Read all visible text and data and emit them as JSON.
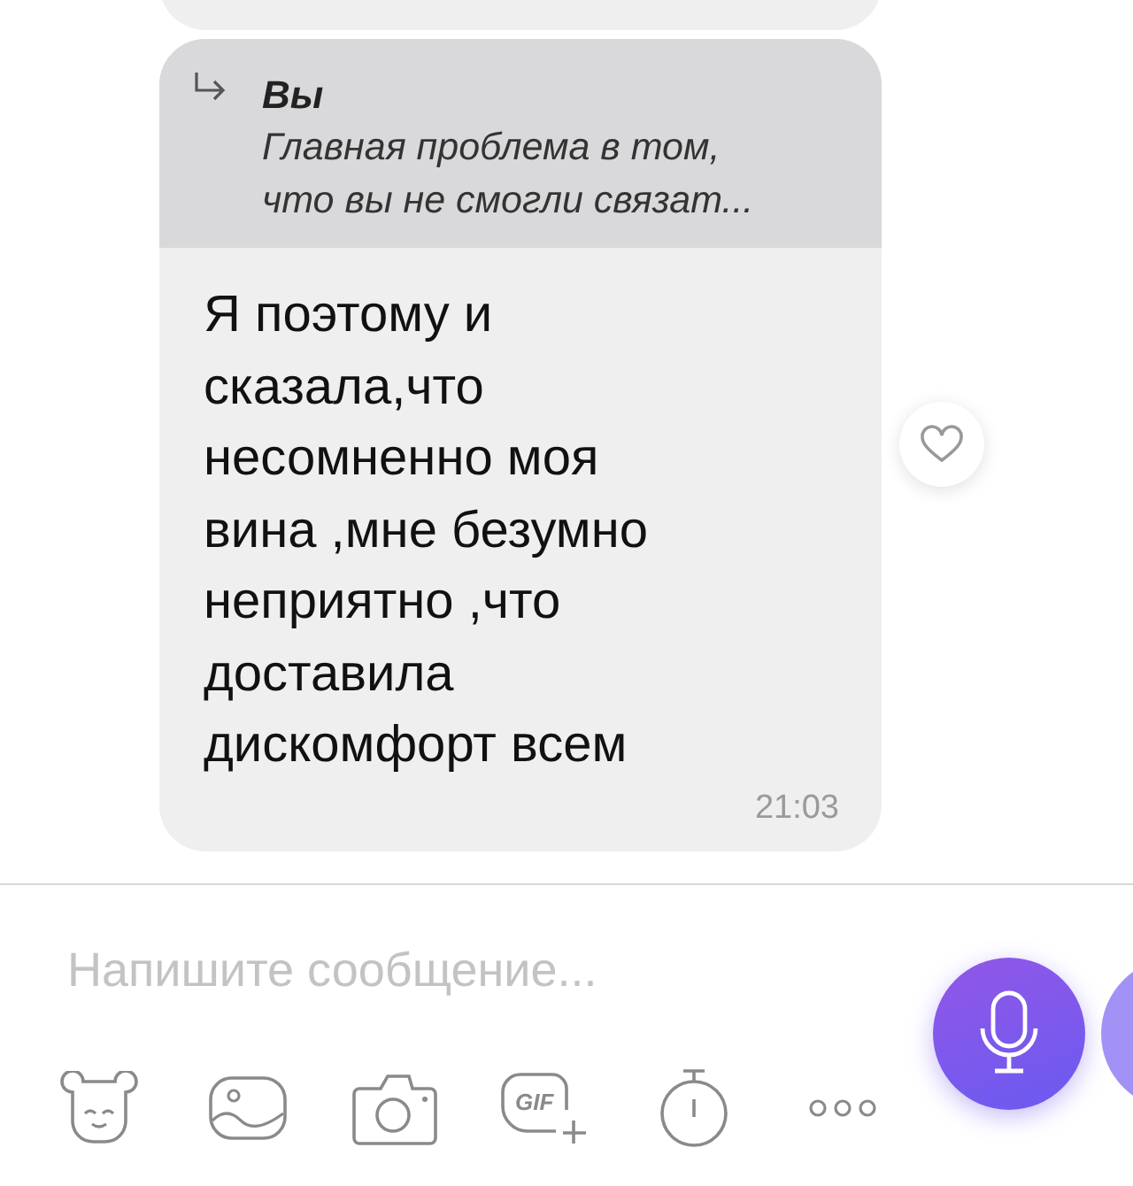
{
  "message": {
    "reply_to": {
      "author": "Вы",
      "text": "Главная проблема в том,\nчто вы не смогли связат..."
    },
    "text": "Я поэтому и\nсказала,что\nнесомненно моя\nвина ,мне безумно\nнеприятно ,что\nдоставила\nдискомфорт всем",
    "time": "21:03"
  },
  "composer": {
    "placeholder": "Напишите сообщение..."
  },
  "toolbar": {
    "gif_label": "GIF"
  }
}
